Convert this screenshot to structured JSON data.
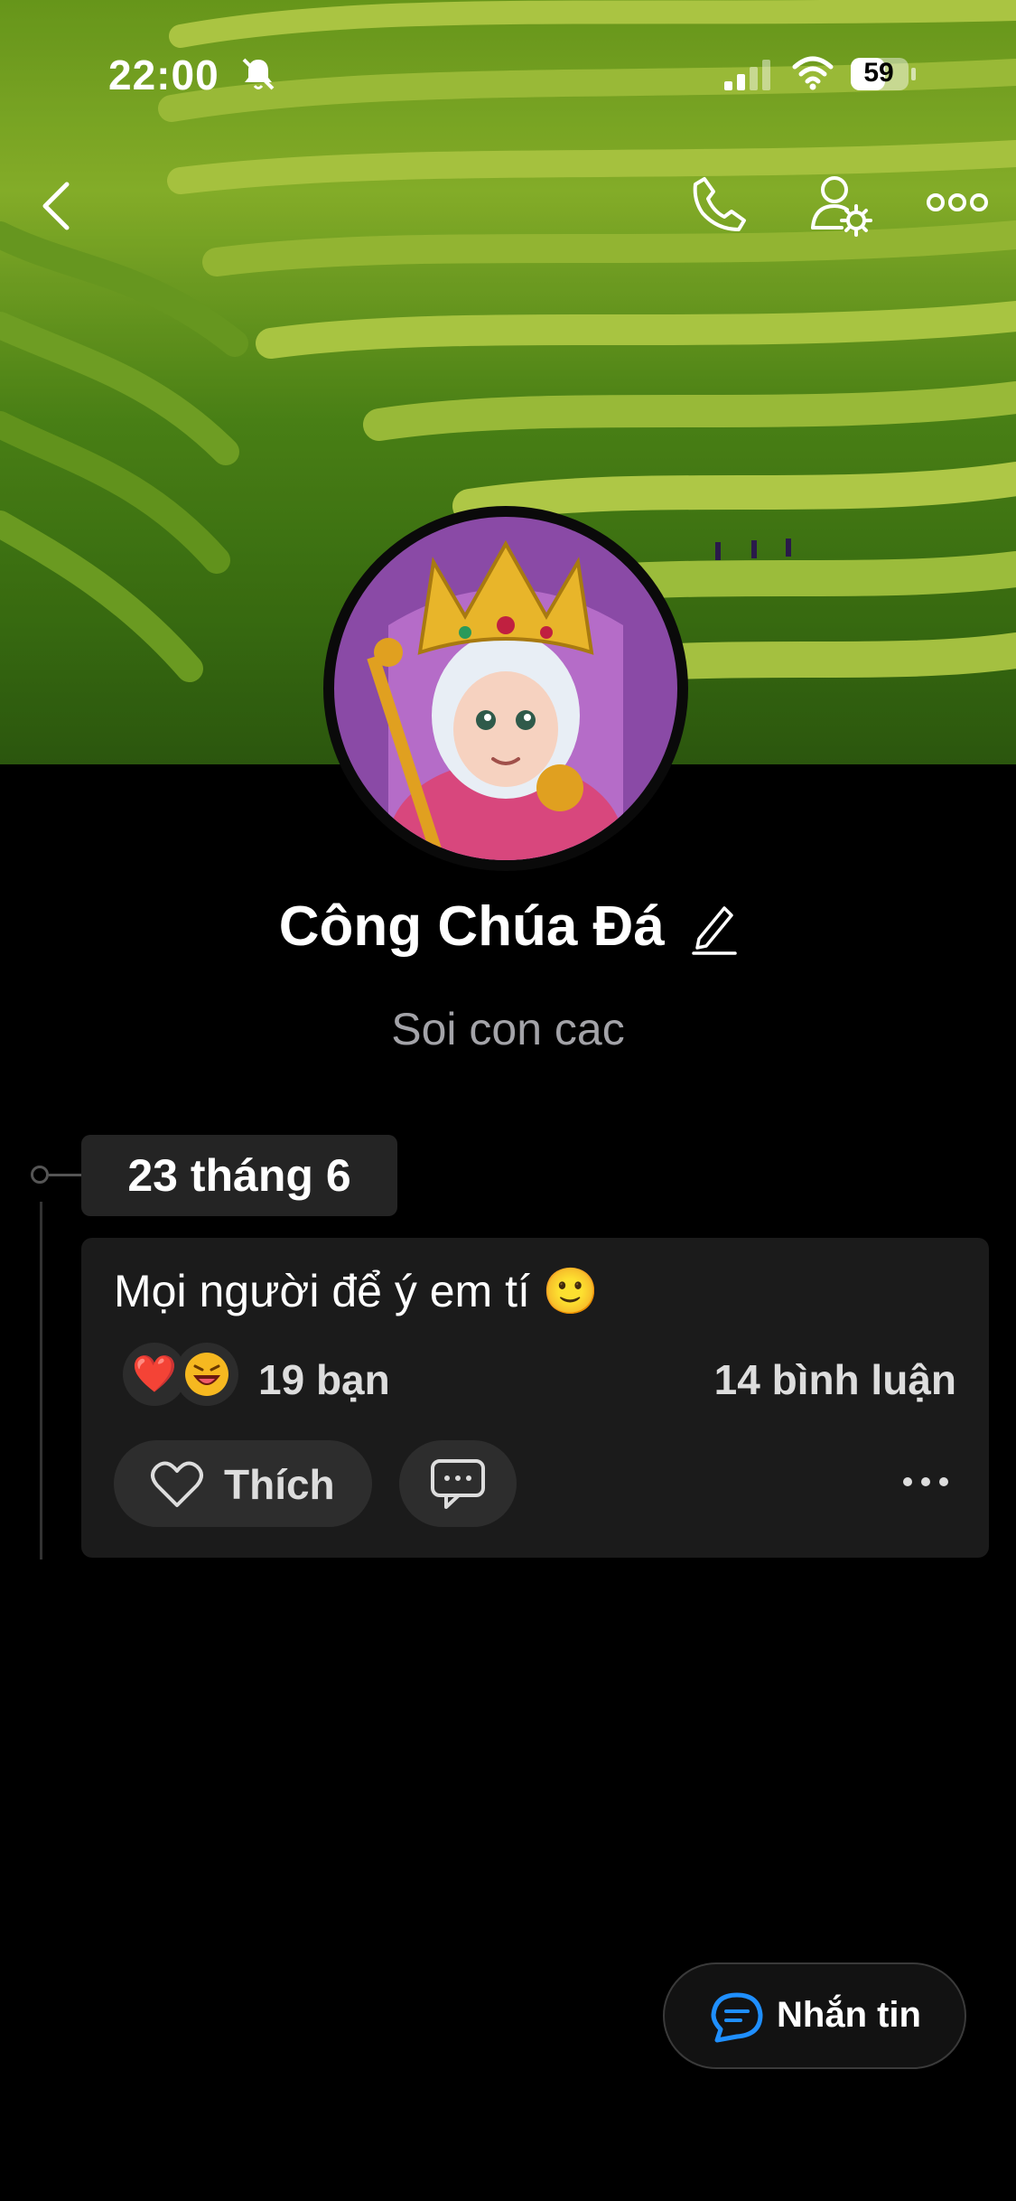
{
  "status_bar": {
    "time": "22:00",
    "battery": "59",
    "icons": [
      "bell-muted-icon",
      "signal-icon",
      "wifi-icon",
      "battery-icon"
    ]
  },
  "header": {
    "icons": [
      "back-icon",
      "phone-icon",
      "user-settings-icon",
      "more-icon"
    ]
  },
  "profile": {
    "name": "Công Chúa Đá",
    "bio": "Soi con cac"
  },
  "timeline": {
    "date": "23 tháng 6",
    "post": {
      "text": "Mọi người để ý em tí 🙂",
      "reactions": [
        "❤️",
        "😫"
      ],
      "reaction_count": "19 bạn",
      "comment_count": "14 bình luận",
      "like_label": "Thích"
    }
  },
  "message_button": {
    "label": "Nhắn tin"
  },
  "colors": {
    "background": "#000000",
    "card": "#1b1b1b",
    "accent": "#1f8fff"
  }
}
